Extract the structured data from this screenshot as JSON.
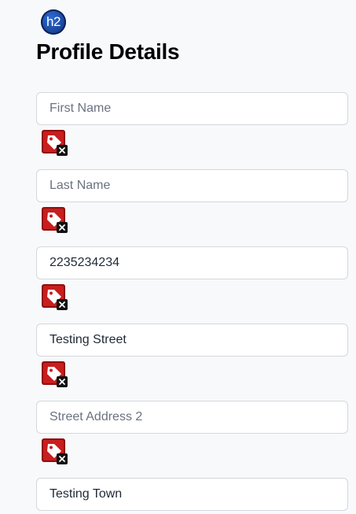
{
  "logo": {
    "text": "h2"
  },
  "page": {
    "title": "Profile Details"
  },
  "fields": [
    {
      "name": "first-name-input",
      "value": "",
      "placeholder": "First Name"
    },
    {
      "name": "last-name-input",
      "value": "",
      "placeholder": "Last Name"
    },
    {
      "name": "phone-input",
      "value": "2235234234",
      "placeholder": ""
    },
    {
      "name": "street-address-input",
      "value": "Testing Street",
      "placeholder": ""
    },
    {
      "name": "street-address-2-input",
      "value": "",
      "placeholder": "Street Address 2"
    },
    {
      "name": "town-input",
      "value": "Testing Town",
      "placeholder": ""
    }
  ],
  "icons": {
    "field_action": "tag-remove-icon"
  },
  "colors": {
    "tag_red": "#c81e1e",
    "tag_dark_red": "#8f0f0f",
    "badge_blue": "#1c4aa3"
  }
}
